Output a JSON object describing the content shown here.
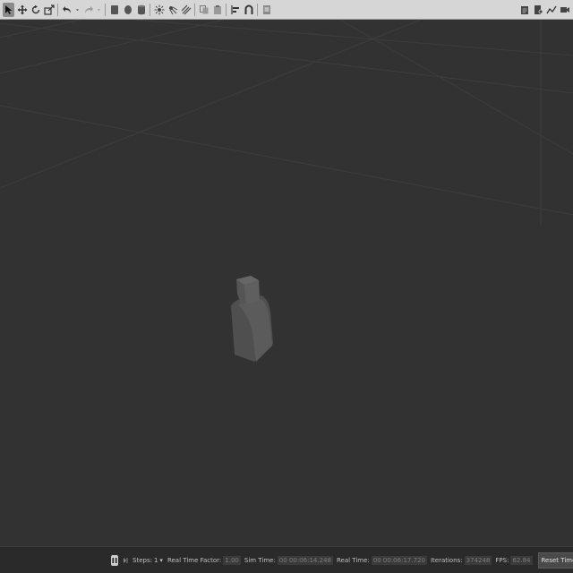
{
  "toolbar": {
    "tools_left": [
      "select-arrow-icon",
      "translate-icon",
      "rotate-icon",
      "scale-icon",
      "undo-icon",
      "undo-dropdown-icon",
      "redo-icon",
      "redo-dropdown-icon",
      "box-shape-icon",
      "sphere-shape-icon",
      "cylinder-shape-icon",
      "point-light-icon",
      "spot-light-icon",
      "directional-light-icon",
      "copy-icon",
      "paste-icon",
      "align-icon",
      "snap-icon",
      "screenshot-icon"
    ],
    "tools_right": [
      "log-icon",
      "record-icon",
      "plot-icon",
      "video-icon"
    ]
  },
  "statusbar": {
    "steps_label": "Steps:",
    "steps_value": "1",
    "rtf_label": "Real Time Factor:",
    "rtf_value": "1.00",
    "sim_time_label": "Sim Time:",
    "sim_time_value": "00 00:06:14.248",
    "real_time_label": "Real Time:",
    "real_time_value": "00 00:06:17.720",
    "iterations_label": "Iterations:",
    "iterations_value": "374248",
    "fps_label": "FPS:",
    "fps_value": "62.84",
    "reset_label": "Reset Time"
  },
  "colors": {
    "toolbar_bg": "#d6d6d6",
    "viewport_bg": "#323232",
    "statusbar_bg": "#2a2a2a",
    "grid_line": "#3f3f3f",
    "object_fill": "#5a5a5a"
  }
}
